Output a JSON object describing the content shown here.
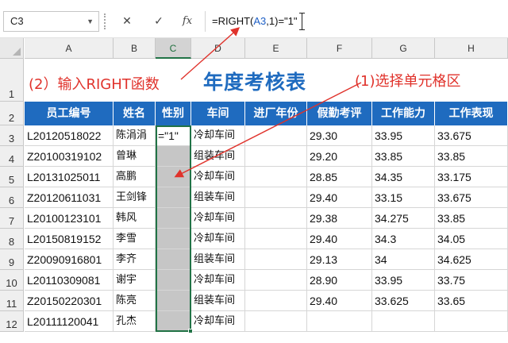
{
  "formula_bar": {
    "name_box": "C3",
    "cancel_symbol": "✕",
    "confirm_symbol": "✓",
    "fx_label": "fx",
    "formula_prefix": "=RIGHT(",
    "formula_ref": "A3",
    "formula_suffix": ",1)=\"1\""
  },
  "columns": [
    "A",
    "B",
    "C",
    "D",
    "E",
    "F",
    "G",
    "H"
  ],
  "rows": [
    "1",
    "2",
    "3",
    "4",
    "5",
    "6",
    "7",
    "8",
    "9",
    "10",
    "11",
    "12"
  ],
  "sheet_title": "年度考核表",
  "annotations": {
    "step2": "(2）输入RIGHT函数",
    "step1": "(1)选择单元格区"
  },
  "table": {
    "headers": [
      "员工编号",
      "姓名",
      "性别",
      "车间",
      "进厂年份",
      "假勤考评",
      "工作能力",
      "工作表现"
    ],
    "rows": [
      [
        "L20120518022",
        "陈涓涓",
        "=\"1\"",
        "冷却车间",
        "",
        "29.30",
        "33.95",
        "33.675"
      ],
      [
        "Z20100319102",
        "曾琳",
        "",
        "组装车间",
        "",
        "29.20",
        "33.85",
        "33.85"
      ],
      [
        "L20131025011",
        "高鹏",
        "",
        "冷却车间",
        "",
        "28.85",
        "34.35",
        "33.175"
      ],
      [
        "Z20120611031",
        "王剑锋",
        "",
        "组装车间",
        "",
        "29.40",
        "33.15",
        "33.675"
      ],
      [
        "L20100123101",
        "韩风",
        "",
        "冷却车间",
        "",
        "29.38",
        "34.275",
        "33.85"
      ],
      [
        "L20150819152",
        "李雪",
        "",
        "冷却车间",
        "",
        "29.40",
        "34.3",
        "34.05"
      ],
      [
        "Z20090916801",
        "李齐",
        "",
        "组装车间",
        "",
        "29.13",
        "34",
        "34.625"
      ],
      [
        "L20110309081",
        "谢宇",
        "",
        "冷却车间",
        "",
        "28.90",
        "33.95",
        "33.75"
      ],
      [
        "Z20150220301",
        "陈亮",
        "",
        "组装车间",
        "",
        "29.40",
        "33.625",
        "33.65"
      ],
      [
        "L20111120041",
        "孔杰",
        "",
        "冷却车间",
        "",
        "",
        "",
        ""
      ]
    ]
  },
  "colors": {
    "header_fill": "#1f6bbf",
    "title_color": "#1f6bbf",
    "annotation_color": "#e0322b",
    "selection_border": "#217346",
    "selected_range_fill": "#c6c6c6"
  }
}
